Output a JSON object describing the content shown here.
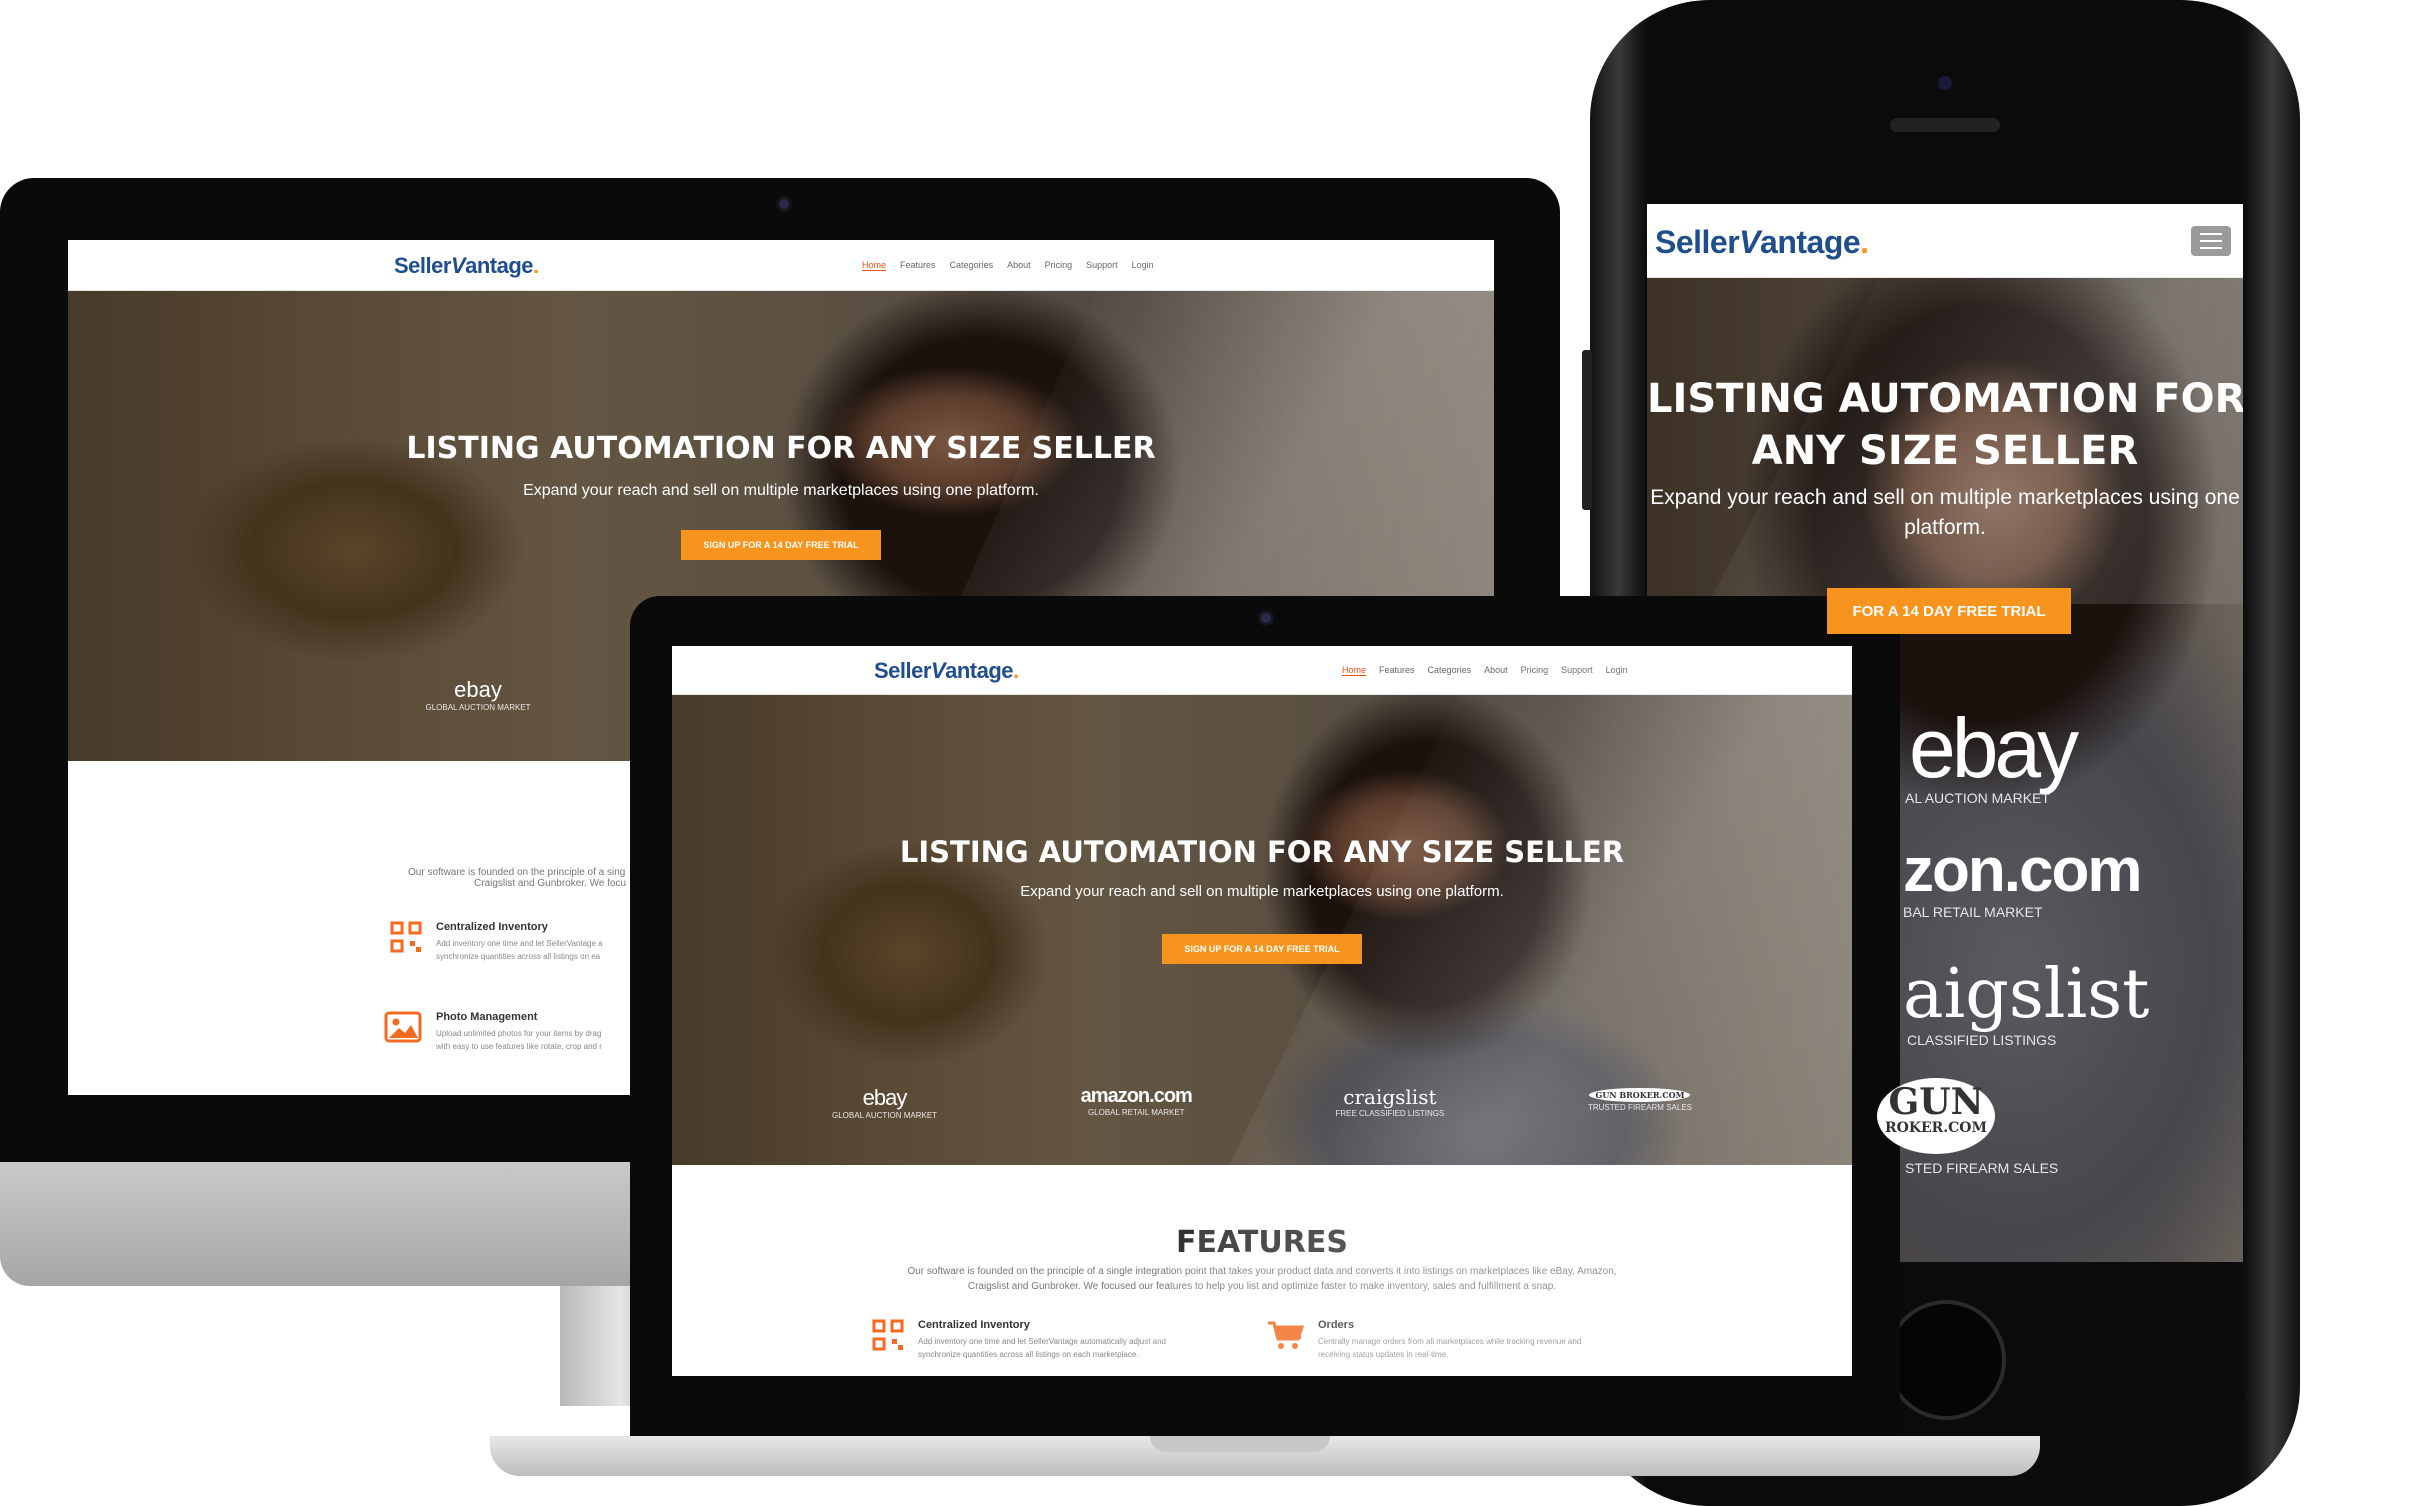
{
  "brand": {
    "logo_prefix": "Seller",
    "logo_suffix": "antage",
    "logo_v": "V",
    "logo_dot": ".",
    "accent": "#f7941d",
    "logo_color": "#1f4e8c"
  },
  "nav": {
    "items": [
      "Home",
      "Features",
      "Categories",
      "About",
      "Pricing",
      "Support",
      "Login"
    ],
    "active": "Home",
    "menu_icon": "hamburger-icon"
  },
  "hero": {
    "title": "LISTING AUTOMATION FOR ANY SIZE SELLER",
    "title_line1": "LISTING AUTOMATION FOR",
    "title_line2": "ANY SIZE SELLER",
    "subtitle": "Expand your reach and sell on multiple marketplaces using one platform.",
    "subtitle_line1": "Expand your reach and sell on multiple marketplaces using one",
    "subtitle_line2": "platform.",
    "cta": "SIGN UP FOR A 14 DAY FREE TRIAL",
    "cta_partial": "FOR A 14 DAY FREE TRIAL"
  },
  "marketplaces": [
    {
      "name": "ebay",
      "caption": "GLOBAL AUCTION MARKET"
    },
    {
      "name": "amazon.com",
      "caption": "GLOBAL RETAIL MARKET"
    },
    {
      "name": "craigslist",
      "caption": "FREE CLASSIFIED LISTINGS"
    },
    {
      "name": "GUN BROKER.COM",
      "caption": "TRUSTED FIREARM SALES"
    }
  ],
  "phone_crops": {
    "ebay": "ebay",
    "ebay_cap": "AL AUCTION MARKET",
    "amazon": "zon.com",
    "amazon_prefix": "a",
    "amazon_cap": "BAL RETAIL MARKET",
    "craigslist": "aigslist",
    "craigslist_cap": "CLASSIFIED LISTINGS",
    "gun": "GUN",
    "gun_sub": "ROKER.COM",
    "gun_cap": "STED FIREARM SALES"
  },
  "features": {
    "title": "FEATURES",
    "intro_line1": "Our software is founded on the principle of a single integration point that takes your product data and converts it into listings on marketplaces like eBay, Amazon,",
    "intro_line2": "Craigslist and Gunbroker. We focused our features to help you list and optimize faster to make inventory, sales and fulfillment a snap.",
    "intro_crop1": "Our software is founded on the principle of a sing",
    "intro_crop2": "Craigslist and Gunbroker. We focu",
    "items": [
      {
        "title": "Centralized Inventory",
        "desc1": "Add inventory one time and let SellerVantage automatically adjust and",
        "desc2": "synchronize quantities across all listings on each marketplace.",
        "icon": "qr-code-icon"
      },
      {
        "title": "Orders",
        "desc1": "Centrally manage orders from all marketplaces while tracking revenue and",
        "desc2": "receiving status updates in real-time.",
        "icon": "shopping-cart-icon"
      },
      {
        "title": "Photo Management",
        "desc1": "Upload unlimited photos for your items by drag",
        "desc2": "with easy to use features like rotate, crop and r",
        "icon": "image-icon"
      }
    ],
    "crop_desc_inventory1": "Add inventory one time and let SellerVantage a",
    "crop_desc_inventory2": "synchronize quantities across all listings on ea"
  }
}
